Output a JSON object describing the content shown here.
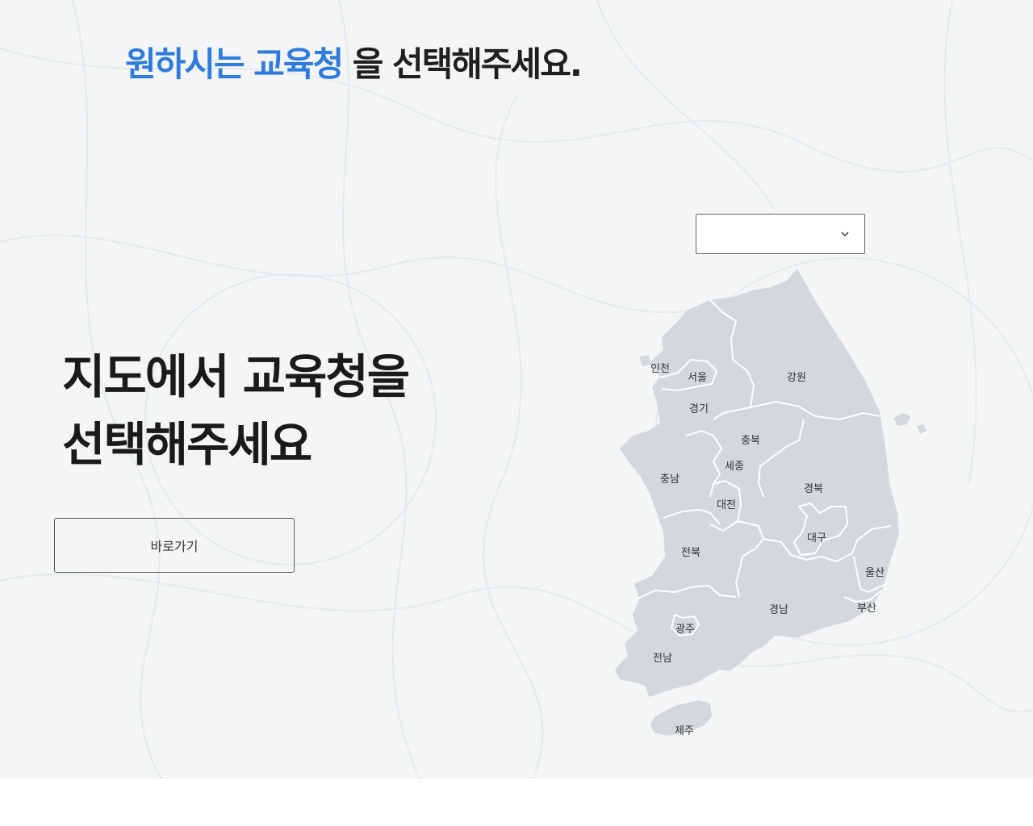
{
  "header": {
    "headline_accent": "원하시는 교육청",
    "headline_rest": "을 선택해주세요."
  },
  "hero": {
    "title_line1": "지도에서 교육청을",
    "title_line2": "선택해주세요",
    "go_button_label": "바로가기"
  },
  "region_select": {
    "selected_value": "",
    "icon": "chevron-down-icon"
  },
  "map": {
    "regions": [
      {
        "id": "incheon",
        "label": "인천"
      },
      {
        "id": "seoul",
        "label": "서울"
      },
      {
        "id": "gyeonggi",
        "label": "경기"
      },
      {
        "id": "gangwon",
        "label": "강원"
      },
      {
        "id": "chungbuk",
        "label": "충북"
      },
      {
        "id": "sejong",
        "label": "세종"
      },
      {
        "id": "chungnam",
        "label": "충남"
      },
      {
        "id": "daejeon",
        "label": "대전"
      },
      {
        "id": "gyeongbuk",
        "label": "경북"
      },
      {
        "id": "daegu",
        "label": "대구"
      },
      {
        "id": "jeonbuk",
        "label": "전북"
      },
      {
        "id": "ulsan",
        "label": "울산"
      },
      {
        "id": "gyeongnam",
        "label": "경남"
      },
      {
        "id": "busan",
        "label": "부산"
      },
      {
        "id": "gwangju",
        "label": "광주"
      },
      {
        "id": "jeonnam",
        "label": "전남"
      },
      {
        "id": "jeju",
        "label": "제주"
      }
    ]
  },
  "colors": {
    "accent": "#2f7bdc",
    "background": "#f3f5f6",
    "map_fill": "#d3d8db",
    "map_border": "#ffffff"
  }
}
